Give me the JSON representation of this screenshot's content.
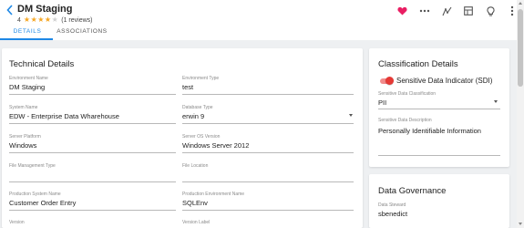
{
  "header": {
    "title": "DM Staging",
    "rating_value": "4",
    "stars_filled": 4,
    "stars_total": 5,
    "reviews": "(1 reviews)",
    "back_icon": "chevron-left-icon",
    "actions": [
      "heart-icon",
      "more-horizontal-icon",
      "lineage-icon",
      "table-icon",
      "lightbulb-icon",
      "more-vertical-icon"
    ]
  },
  "tabs": [
    {
      "label": "DETAILS",
      "active": true
    },
    {
      "label": "ASSOCIATIONS",
      "active": false
    }
  ],
  "technical_details": {
    "title": "Technical Details",
    "fields": {
      "environment_name": {
        "label": "Environment Name",
        "value": "DM Staging"
      },
      "environment_type": {
        "label": "Environment Type",
        "value": "test"
      },
      "system_name": {
        "label": "System Name",
        "value": "EDW - Enterprise Data Wharehouse"
      },
      "database_type": {
        "label": "Database Type",
        "value": "erwin 9"
      },
      "server_platform": {
        "label": "Server Platform",
        "value": "Windows"
      },
      "server_os_version": {
        "label": "Server OS Version",
        "value": "Windows Server 2012"
      },
      "file_management_type": {
        "label": "File Management Type",
        "value": ""
      },
      "file_location": {
        "label": "File Location",
        "value": ""
      },
      "production_system_name": {
        "label": "Production System Name",
        "value": "Customer Order Entry"
      },
      "production_environment_name": {
        "label": "Production Environment Name",
        "value": "SQLEnv"
      },
      "version": {
        "label": "Version",
        "value": ""
      },
      "version_label": {
        "label": "Version Label",
        "value": ""
      }
    }
  },
  "classification_details": {
    "title": "Classification Details",
    "sdi_label": "Sensitive Data Indicator (SDI)",
    "sdi_enabled": true,
    "sdi_classification": {
      "label": "Sensitive Data Classification",
      "value": "PII"
    },
    "sdi_description": {
      "label": "Sensitive Data Description",
      "value": "Personally Identifiable Information"
    }
  },
  "data_governance": {
    "title": "Data Governance",
    "data_steward": {
      "label": "Data Steward",
      "value": "sbenedict"
    }
  },
  "colors": {
    "accent": "#1e88e5",
    "star": "#f5a623",
    "heart": "#e91e63",
    "toggle_on": "#e53935"
  }
}
